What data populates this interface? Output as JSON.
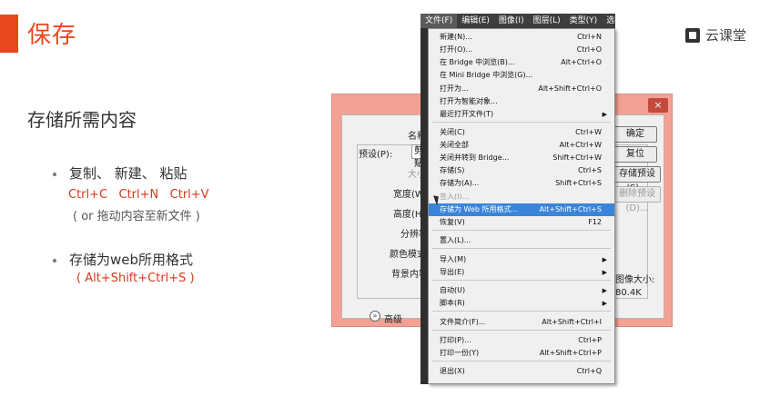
{
  "slide": {
    "title": "保存",
    "brand": "云课堂",
    "subtitle": "存储所需内容",
    "bullet1": "复制、 新建、 粘贴",
    "shortcut1": "Ctrl+C   Ctrl+N   Ctrl+V",
    "note1": "( or 拖动内容至新文件 )",
    "bullet2": "存储为web所用格式",
    "shortcut2": "( Alt+Shift+Ctrl+S )"
  },
  "dialog": {
    "close": "×",
    "name_label": "名称(N",
    "preset_label": "预设(P):",
    "preset_value": "剪贴",
    "size_label": "大小(I",
    "width_label": "宽度(W",
    "height_label": "高度(H",
    "resolution_label": "分辨率(R",
    "color_mode_label": "颜色模式(M",
    "bg_label": "背景内容(C",
    "advanced_label": "高级",
    "btn_ok": "确定",
    "btn_reset": "复位",
    "btn_save_preset": "存储预设(S)...",
    "btn_delete_preset": "删除预设(D)...",
    "image_size_label": "图像大小:",
    "image_size_value": "80.4K"
  },
  "menubar": {
    "items": [
      "文件(F)",
      "编辑(E)",
      "图像(I)",
      "图层(L)",
      "类型(Y)",
      "选择"
    ]
  },
  "menu": {
    "items": [
      {
        "label": "新建(N)...",
        "shortcut": "Ctrl+N"
      },
      {
        "label": "打开(O)...",
        "shortcut": "Ctrl+O"
      },
      {
        "label": "在 Bridge 中浏览(B)...",
        "shortcut": "Alt+Ctrl+O"
      },
      {
        "label": "在 Mini Bridge 中浏览(G)...",
        "shortcut": ""
      },
      {
        "label": "打开为...",
        "shortcut": "Alt+Shift+Ctrl+O"
      },
      {
        "label": "打开为智能对象...",
        "shortcut": ""
      },
      {
        "label": "最近打开文件(T)",
        "shortcut": "",
        "submenu": "▶"
      },
      {
        "label": "关闭(C)",
        "shortcut": "Ctrl+W"
      },
      {
        "label": "关闭全部",
        "shortcut": "Alt+Ctrl+W"
      },
      {
        "label": "关闭并转到 Bridge...",
        "shortcut": "Shift+Ctrl+W"
      },
      {
        "label": "存储(S)",
        "shortcut": "Ctrl+S"
      },
      {
        "label": "存储为(A)...",
        "shortcut": "Shift+Ctrl+S"
      },
      {
        "label": "签入(I)...",
        "shortcut": ""
      },
      {
        "label": "存储为 Web 所用格式...",
        "shortcut": "Alt+Shift+Ctrl+S"
      },
      {
        "label": "恢复(V)",
        "shortcut": "F12"
      },
      {
        "label": "置入(L)...",
        "shortcut": ""
      },
      {
        "label": "导入(M)",
        "shortcut": "",
        "submenu": "▶"
      },
      {
        "label": "导出(E)",
        "shortcut": "",
        "submenu": "▶"
      },
      {
        "label": "自动(U)",
        "shortcut": "",
        "submenu": "▶"
      },
      {
        "label": "脚本(R)",
        "shortcut": "",
        "submenu": "▶"
      },
      {
        "label": "文件简介(F)...",
        "shortcut": "Alt+Shift+Ctrl+I"
      },
      {
        "label": "打印(P)...",
        "shortcut": "Ctrl+P"
      },
      {
        "label": "打印一份(Y)",
        "shortcut": "Alt+Shift+Ctrl+P"
      },
      {
        "label": "退出(X)",
        "shortcut": "Ctrl+Q"
      }
    ]
  },
  "colors": {
    "accent": "#e8471f",
    "shortcut_red": "#d23a1a",
    "dialog_frame": "#f2a194",
    "menu_highlight": "#3a85d9"
  }
}
